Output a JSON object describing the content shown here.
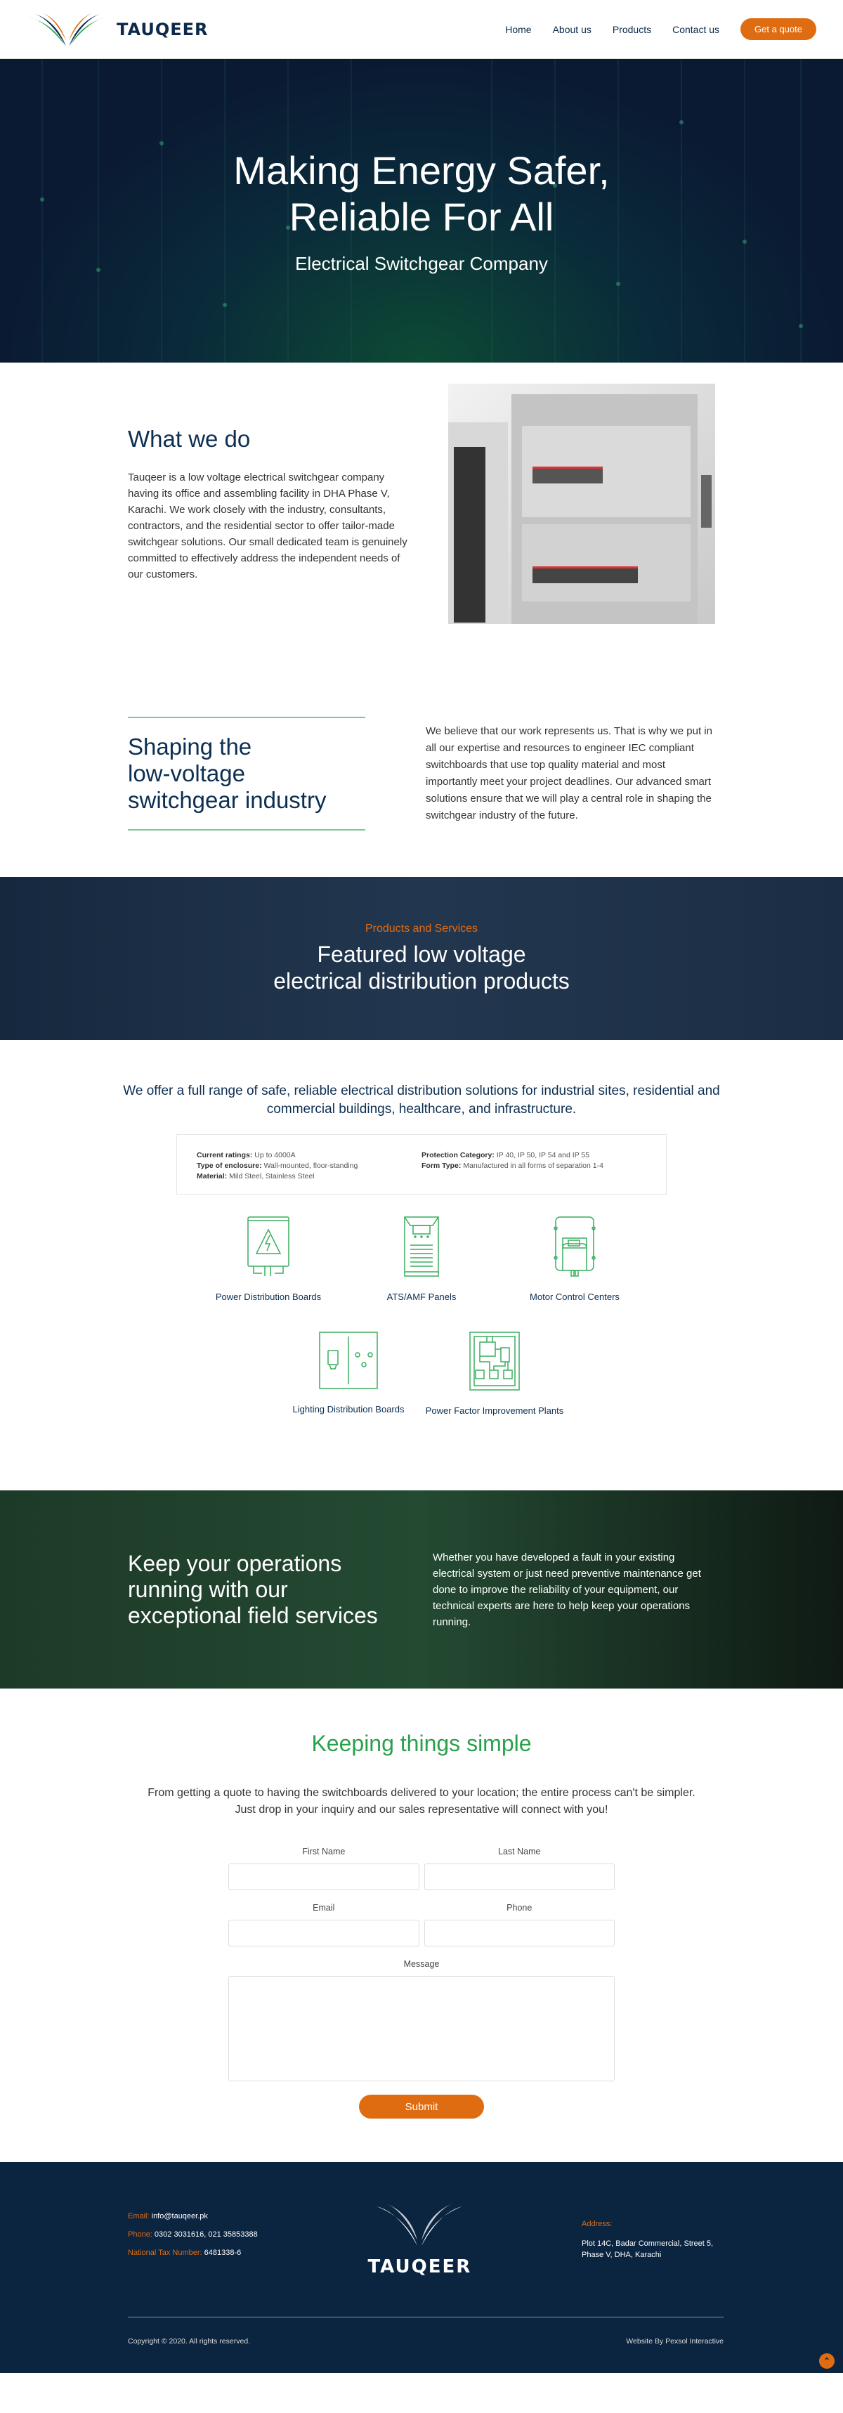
{
  "header": {
    "logo_text": "TAUQEER",
    "nav": [
      "Home",
      "About us",
      "Products",
      "Contact us"
    ],
    "cta": "Get a quote"
  },
  "hero": {
    "title_line1": "Making Energy Safer,",
    "title_line2": "Reliable For All",
    "subtitle": "Electrical Switchgear Company"
  },
  "what_we_do": {
    "title": "What we do",
    "body": "Tauqeer is a low voltage electrical switchgear company having its office and assembling facility in DHA Phase V, Karachi. We work closely with the industry, consultants, contractors, and the residential sector to offer tailor-made switchgear solutions. Our small dedicated team is genuinely committed to effectively address the independent needs of our customers."
  },
  "shaping": {
    "title_line1": "Shaping the",
    "title_line2": "low-voltage",
    "title_line3": "switchgear industry",
    "body": "We believe that our work represents us. That is why we put in all our expertise and resources to engineer IEC compliant switchboards that use top quality material and most importantly meet your project deadlines. Our advanced smart solutions ensure that we will play a central role in shaping the switchgear industry of the future."
  },
  "products_banner": {
    "eyebrow": "Products and Services",
    "title_line1": "Featured low voltage",
    "title_line2": "electrical distribution products"
  },
  "offer": "We offer a full range of safe, reliable electrical distribution solutions for industrial sites, residential and commercial buildings, healthcare, and infrastructure.",
  "specs": {
    "left": [
      {
        "k": "Current ratings:",
        "v": " Up to 4000A"
      },
      {
        "k": "Type of enclosure:",
        "v": " Wall-mounted, floor-standing"
      },
      {
        "k": "Material:",
        "v": " Mild Steel, Stainless Steel"
      }
    ],
    "right": [
      {
        "k": "Protection Category:",
        "v": " IP 40, IP 50, IP 54 and IP 55"
      },
      {
        "k": "Form Type:",
        "v": " Manufactured in all forms of separation 1-4"
      }
    ]
  },
  "products": [
    {
      "label": "Power Distribution Boards",
      "icon": "power-distribution-board-icon"
    },
    {
      "label": "ATS/AMF Panels",
      "icon": "ats-amf-panel-icon"
    },
    {
      "label": "Motor Control Centers",
      "icon": "motor-control-center-icon"
    },
    {
      "label": "Lighting Distribution Boards",
      "icon": "lighting-distribution-board-icon"
    },
    {
      "label": "Power Factor Improvement Plants",
      "icon": "power-factor-plant-icon"
    }
  ],
  "field_services": {
    "title": "Keep your operations running with our exceptional field services",
    "body": "Whether you have developed a fault in your existing electrical system or just need preventive maintenance get done to improve the reliability of your equipment, our technical experts are here to help keep your operations running."
  },
  "simple": {
    "title": "Keeping things simple",
    "body": "From getting a quote to having the switchboards delivered to your location; the entire process can't be simpler. Just drop in your inquiry and our sales representative will connect with you!"
  },
  "form": {
    "first_name": "First Name",
    "last_name": "Last Name",
    "email": "Email",
    "phone": "Phone",
    "message": "Message",
    "submit": "Submit"
  },
  "footer": {
    "email_label": "Email:",
    "email": " info@tauqeer.pk",
    "phone_label": "Phone:",
    "phone": " 0302 3031616, 021 35853388",
    "ntn_label": "National Tax Number:",
    "ntn": " 6481338-6",
    "logo_text": "TAUQEER",
    "address_label": "Address:",
    "address": "Plot 14C, Badar Commercial, Street 5, Phase V, DHA, Karachi",
    "copyright": "Copyright © 2020. All rights reserved.",
    "credit": "Website By Pexsol Interactive"
  },
  "colors": {
    "navy": "#0c2f52",
    "orange": "#e06c12",
    "green": "#2aa04d",
    "footer_bg": "#0b2440"
  }
}
